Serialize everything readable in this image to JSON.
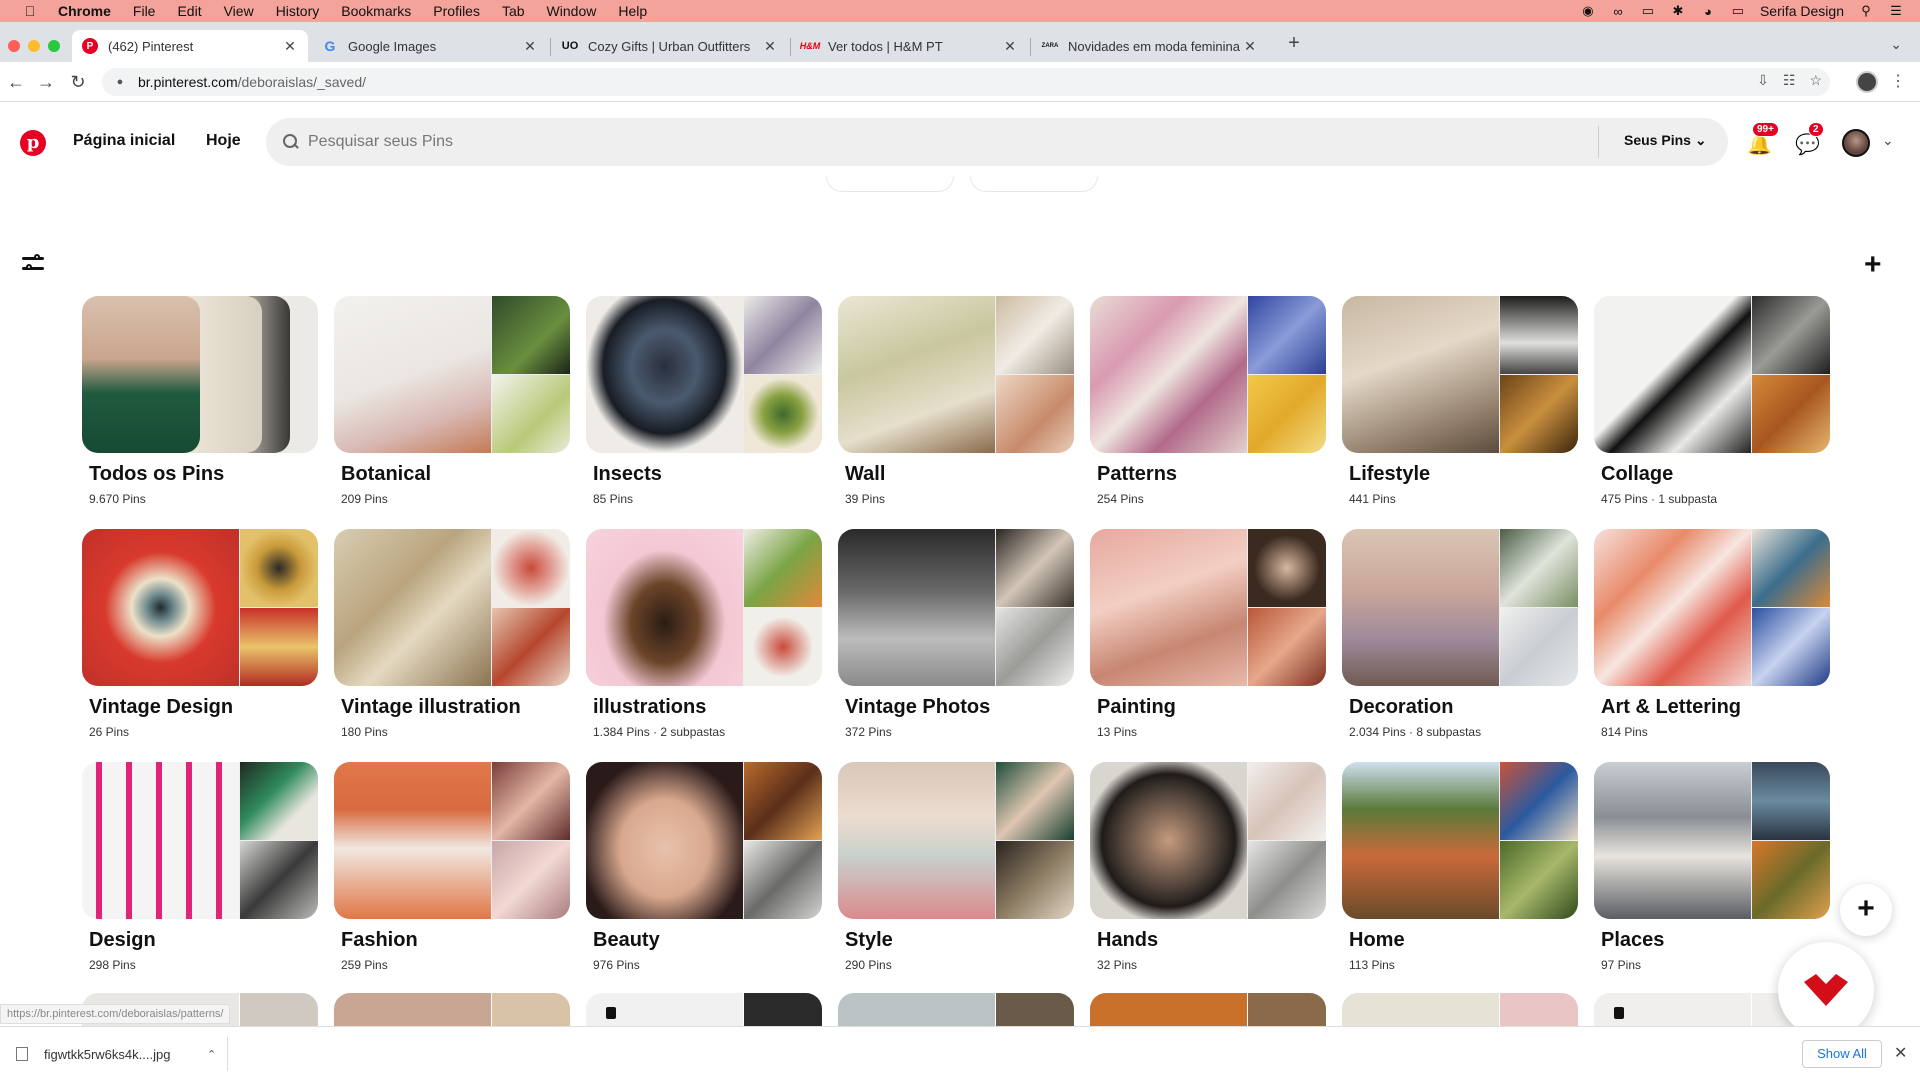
{
  "menubar": {
    "app": "Chrome",
    "items": [
      "File",
      "Edit",
      "View",
      "History",
      "Bookmarks",
      "Profiles",
      "Tab",
      "Window",
      "Help"
    ],
    "user": "Serifa Design"
  },
  "tabs": [
    {
      "title": "(462) Pinterest",
      "favicon": "P",
      "active": true
    },
    {
      "title": "Google Images",
      "favicon": "G",
      "active": false
    },
    {
      "title": "Cozy Gifts | Urban Outfitters",
      "favicon": "UO",
      "active": false
    },
    {
      "title": "Ver todos | H&M PT",
      "favicon": "H&M",
      "active": false
    },
    {
      "title": "Novidades em moda feminina |",
      "favicon": "ZARA",
      "active": false
    }
  ],
  "address": {
    "host": "br.pinterest.com",
    "path": "/deboraislas/_saved/"
  },
  "pinterest": {
    "nav_home": "Página inicial",
    "nav_today": "Hoje",
    "search_placeholder": "Pesquisar seus Pins",
    "your_pins": "Seus Pins",
    "notifications_badge": "99+",
    "messages_badge": "2"
  },
  "boards": [
    {
      "name": "Todos os Pins",
      "count": "9.670 Pins"
    },
    {
      "name": "Botanical",
      "count": "209 Pins"
    },
    {
      "name": "Insects",
      "count": "85 Pins"
    },
    {
      "name": "Wall",
      "count": "39 Pins"
    },
    {
      "name": "Patterns",
      "count": "254 Pins"
    },
    {
      "name": "Lifestyle",
      "count": "441 Pins"
    },
    {
      "name": "Collage",
      "count": "475 Pins · 1 subpasta"
    },
    {
      "name": "Vintage Design",
      "count": "26 Pins"
    },
    {
      "name": "Vintage illustration",
      "count": "180 Pins"
    },
    {
      "name": "illustrations",
      "count": "1.384 Pins · 2 subpastas"
    },
    {
      "name": "Vintage Photos",
      "count": "372 Pins"
    },
    {
      "name": "Painting",
      "count": "13 Pins"
    },
    {
      "name": "Decoration",
      "count": "2.034 Pins · 8 subpastas"
    },
    {
      "name": "Art & Lettering",
      "count": "814 Pins"
    },
    {
      "name": "Design",
      "count": "298 Pins"
    },
    {
      "name": "Fashion",
      "count": "259 Pins"
    },
    {
      "name": "Beauty",
      "count": "976 Pins"
    },
    {
      "name": "Style",
      "count": "290 Pins"
    },
    {
      "name": "Hands",
      "count": "32 Pins"
    },
    {
      "name": "Home",
      "count": "113 Pins"
    },
    {
      "name": "Places",
      "count": "97 Pins"
    }
  ],
  "colors": {
    "pinterest_red": "#e60023",
    "menubar": "#f4a39b"
  },
  "status_url": "https://br.pinterest.com/deboraislas/patterns/",
  "download": {
    "filename": "figwtkk5rw6ks4k....jpg",
    "show_all": "Show All"
  }
}
